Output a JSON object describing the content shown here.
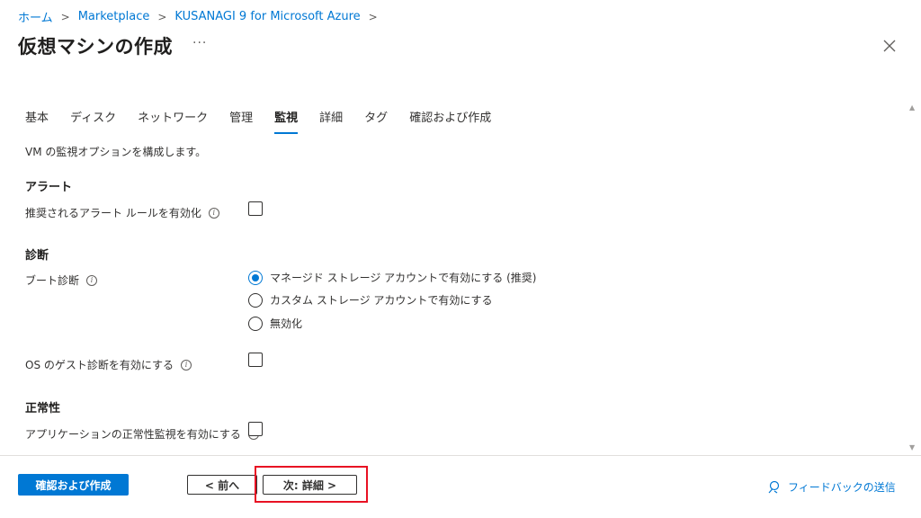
{
  "breadcrumb": {
    "items": [
      "ホーム",
      "Marketplace",
      "KUSANAGI 9 for Microsoft Azure"
    ],
    "separator": ">"
  },
  "page": {
    "title": "仮想マシンの作成",
    "more_label": "···"
  },
  "tabs": [
    "基本",
    "ディスク",
    "ネットワーク",
    "管理",
    "監視",
    "詳細",
    "タグ",
    "確認および作成"
  ],
  "active_tab": "監視",
  "description": "VM の監視オプションを構成します。",
  "alert": {
    "heading": "アラート",
    "rule_label": "推奨されるアラート ルールを有効化",
    "rule_checked": false
  },
  "diagnostics": {
    "heading": "診断",
    "boot_label": "ブート診断",
    "options": [
      "マネージド ストレージ アカウントで有効にする (推奨)",
      "カスタム ストレージ アカウントで有効にする",
      "無効化"
    ],
    "selected_option": "マネージド ストレージ アカウントで有効にする (推奨)",
    "guest_label": "OS のゲスト診断を有効にする",
    "guest_checked": false
  },
  "health": {
    "heading": "正常性",
    "app_label": "アプリケーションの正常性監視を有効にする",
    "app_checked": false
  },
  "info_glyph": "i",
  "footer": {
    "review_button": "確認および作成",
    "prev_button": "< 前へ",
    "next_button": "次: 詳細 >",
    "feedback": "フィードバックの送信"
  },
  "colors": {
    "accent": "#0078d4",
    "highlight": "#e81123"
  }
}
